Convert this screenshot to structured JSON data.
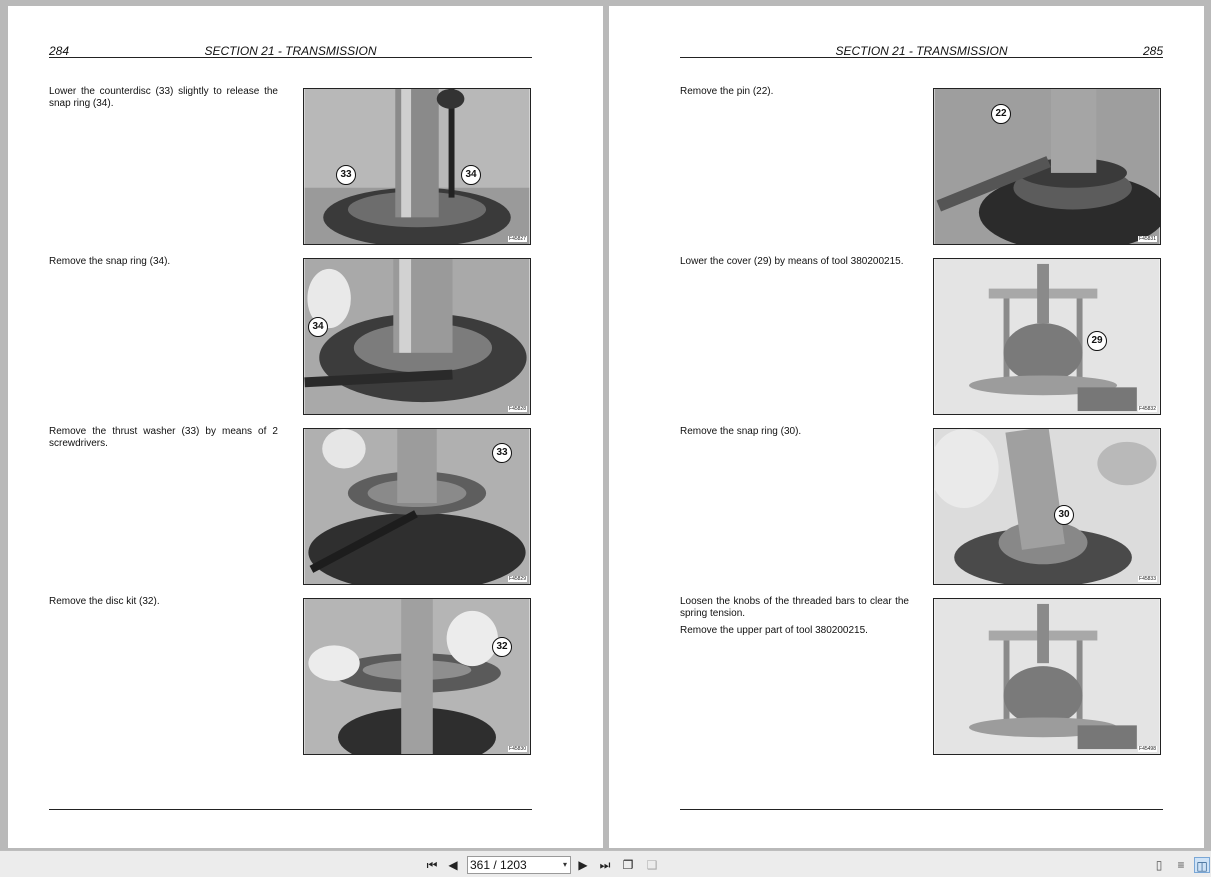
{
  "left_page": {
    "page_number": "284",
    "section_title": "SECTION 21 - TRANSMISSION",
    "steps": [
      {
        "text": [
          "Lower the counterdisc (33) slightly to release the snap ring (34)."
        ],
        "figure_id": "F45827",
        "callouts": [
          "33",
          "34"
        ]
      },
      {
        "text": [
          "Remove the snap ring (34)."
        ],
        "figure_id": "F45828",
        "callouts": [
          "34"
        ]
      },
      {
        "text": [
          "Remove the thrust washer (33) by means of 2 screwdrivers."
        ],
        "figure_id": "F45829",
        "callouts": [
          "33"
        ]
      },
      {
        "text": [
          "Remove the disc kit (32)."
        ],
        "figure_id": "F45830",
        "callouts": [
          "32"
        ]
      }
    ]
  },
  "right_page": {
    "page_number": "285",
    "section_title": "SECTION 21 - TRANSMISSION",
    "steps": [
      {
        "text": [
          "Remove the pin (22)."
        ],
        "figure_id": "F45831",
        "callouts": [
          "22"
        ]
      },
      {
        "text": [
          "Lower the cover (29) by means of tool 380200215."
        ],
        "figure_id": "F45832",
        "callouts": [
          "29"
        ]
      },
      {
        "text": [
          "Remove the snap ring (30)."
        ],
        "figure_id": "F45833",
        "callouts": [
          "30"
        ]
      },
      {
        "text": [
          "Loosen the knobs of the threaded bars to clear the spring tension.",
          "Remove the upper part of tool 380200215."
        ],
        "figure_id": "F45498",
        "callouts": []
      }
    ]
  },
  "toolbar": {
    "page_field": "361 / 1203",
    "icons": [
      "first-page-icon",
      "previous-page-icon",
      "next-page-icon",
      "last-page-icon",
      "copy-page-icon",
      "paste-page-icon",
      "single-page-view-icon",
      "continuous-view-icon",
      "two-page-view-icon"
    ]
  }
}
